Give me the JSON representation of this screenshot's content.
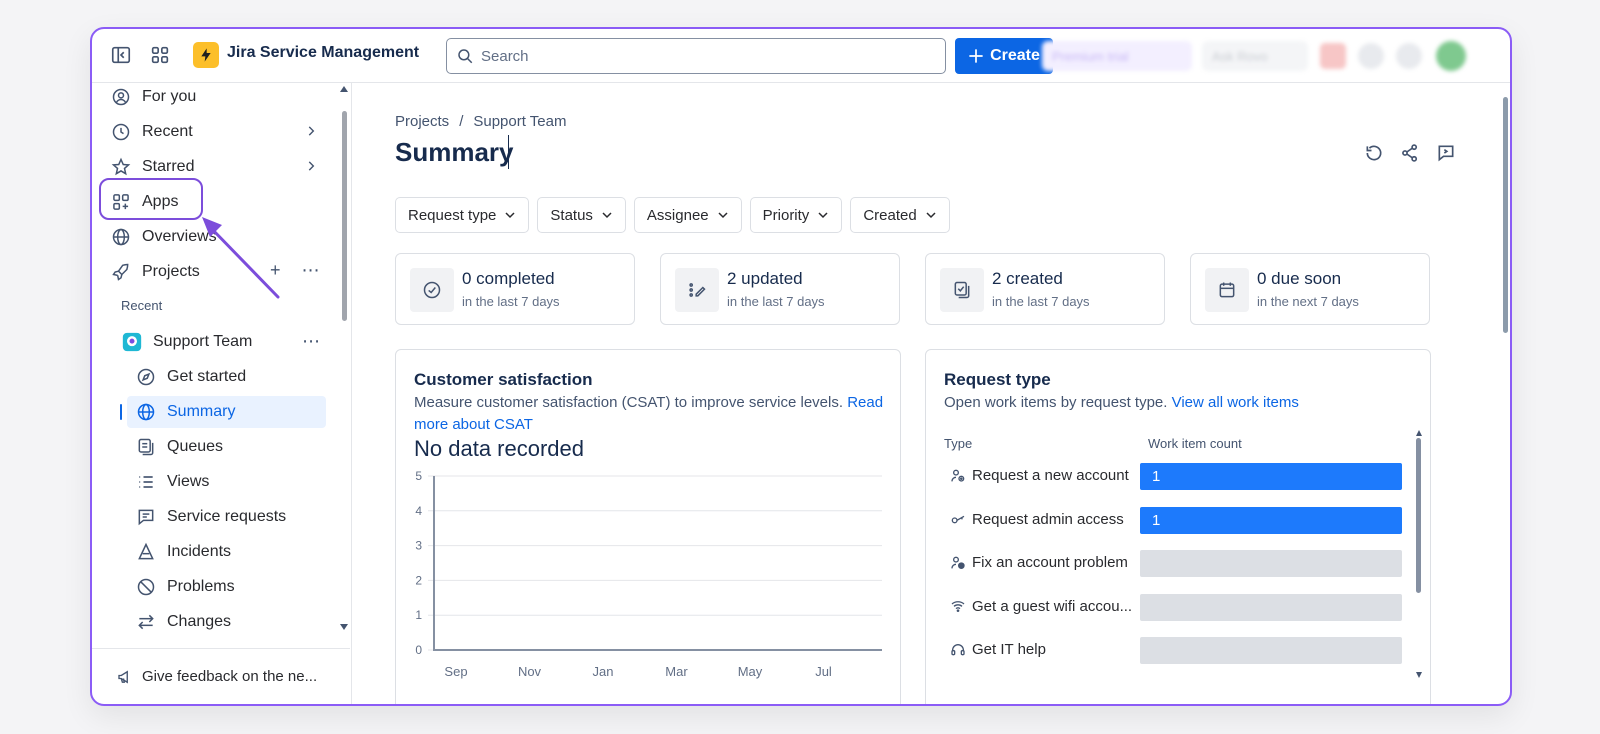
{
  "app": {
    "title": "Jira Service Management"
  },
  "topbar": {
    "search_placeholder": "Search",
    "create_label": "Create",
    "blurred": [
      "Premium trial",
      "Ask Rovo"
    ]
  },
  "sidebar": {
    "items": [
      {
        "label": "For you",
        "icon": "person-icon"
      },
      {
        "label": "Recent",
        "icon": "clock-icon"
      },
      {
        "label": "Starred",
        "icon": "star-icon"
      },
      {
        "label": "Apps",
        "icon": "apps-icon"
      },
      {
        "label": "Overviews",
        "icon": "globe-icon"
      },
      {
        "label": "Projects",
        "icon": "rocket-icon"
      }
    ],
    "recent_label": "Recent",
    "project": {
      "name": "Support Team"
    },
    "project_items": [
      {
        "label": "Get started",
        "icon": "compass-icon"
      },
      {
        "label": "Summary",
        "icon": "globe-icon",
        "active": true
      },
      {
        "label": "Queues",
        "icon": "queue-icon"
      },
      {
        "label": "Views",
        "icon": "list-icon"
      },
      {
        "label": "Service requests",
        "icon": "comment-icon"
      },
      {
        "label": "Incidents",
        "icon": "warning-icon"
      },
      {
        "label": "Problems",
        "icon": "ban-icon"
      },
      {
        "label": "Changes",
        "icon": "swap-icon"
      }
    ],
    "feedback": "Give feedback on the ne..."
  },
  "main": {
    "breadcrumb": [
      "Projects",
      "Support Team"
    ],
    "title": "Summary",
    "filters": [
      "Request type",
      "Status",
      "Assignee",
      "Priority",
      "Created"
    ],
    "stats": [
      {
        "main": "0 completed",
        "sub": "in the last 7 days"
      },
      {
        "main": "2 updated",
        "sub": "in the last 7 days"
      },
      {
        "main": "2 created",
        "sub": "in the last 7 days"
      },
      {
        "main": "0 due soon",
        "sub": "in the next 7 days"
      }
    ],
    "csat": {
      "title": "Customer satisfaction",
      "desc": "Measure customer satisfaction (CSAT) to improve service levels.",
      "link": "Read more about CSAT",
      "nodata": "No data recorded"
    },
    "request_type": {
      "title": "Request type",
      "desc": "Open work items by request type.",
      "link": "View all work items",
      "col_type": "Type",
      "col_count": "Work item count",
      "rows": [
        {
          "label": "Request a new account",
          "count": 1,
          "value_text": "1"
        },
        {
          "label": "Request admin access",
          "count": 1,
          "value_text": "1"
        },
        {
          "label": "Fix an account problem",
          "count": 0,
          "value_text": ""
        },
        {
          "label": "Get a guest wifi accou...",
          "count": 0,
          "value_text": ""
        },
        {
          "label": "Get IT help",
          "count": 0,
          "value_text": ""
        }
      ]
    }
  },
  "chart_data": {
    "type": "line",
    "title": "No data recorded",
    "categories": [
      "Sep",
      "Nov",
      "Jan",
      "Mar",
      "May",
      "Jul"
    ],
    "series": [],
    "ylim": [
      0,
      5
    ],
    "yticks": [
      "0",
      "1",
      "2",
      "3",
      "4",
      "5"
    ],
    "grid": true
  }
}
